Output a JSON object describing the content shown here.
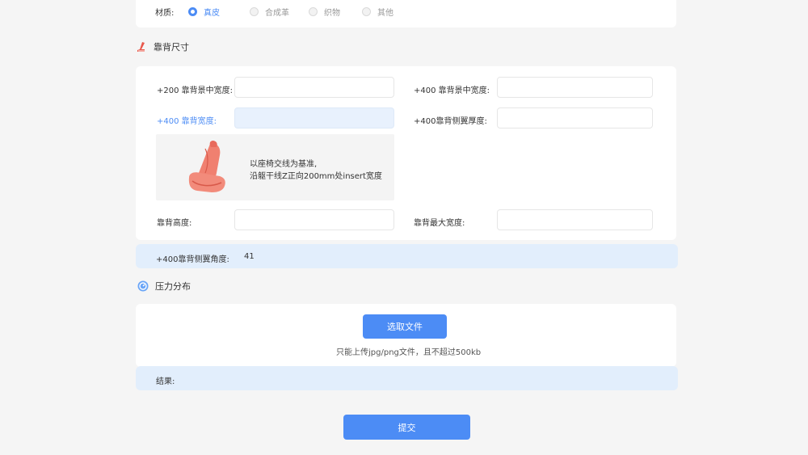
{
  "material": {
    "label": "材质:",
    "options": [
      {
        "label": "真皮",
        "selected": true
      },
      {
        "label": "合成革",
        "selected": false
      },
      {
        "label": "织物",
        "selected": false
      },
      {
        "label": "其他",
        "selected": false
      }
    ]
  },
  "backrest": {
    "title": "靠背尺寸",
    "fields": {
      "center_width_200": "+200 靠背景中宽度:",
      "center_width_400": "+400 靠背景中宽度:",
      "width_400": "+400 靠背宽度:",
      "wing_thickness_400": "+400靠背侧翼厚度:",
      "height": "靠背高度:",
      "max_width": "靠背最大宽度:"
    },
    "hint_line1": "以座椅交线为基准,",
    "hint_line2": "沿躯干线Z正向200mm处insert宽度",
    "angle_label": "+400靠背侧翼角度:",
    "angle_value": "41"
  },
  "pressure": {
    "title": "压力分布",
    "choose_file_label": "选取文件",
    "upload_note": "只能上传jpg/png文件，且不超过500kb",
    "result_label": "结果:"
  },
  "submit_label": "提交",
  "colors": {
    "accent": "#4c8cf5",
    "band": "#e2eefc",
    "seat": "#f08070"
  }
}
